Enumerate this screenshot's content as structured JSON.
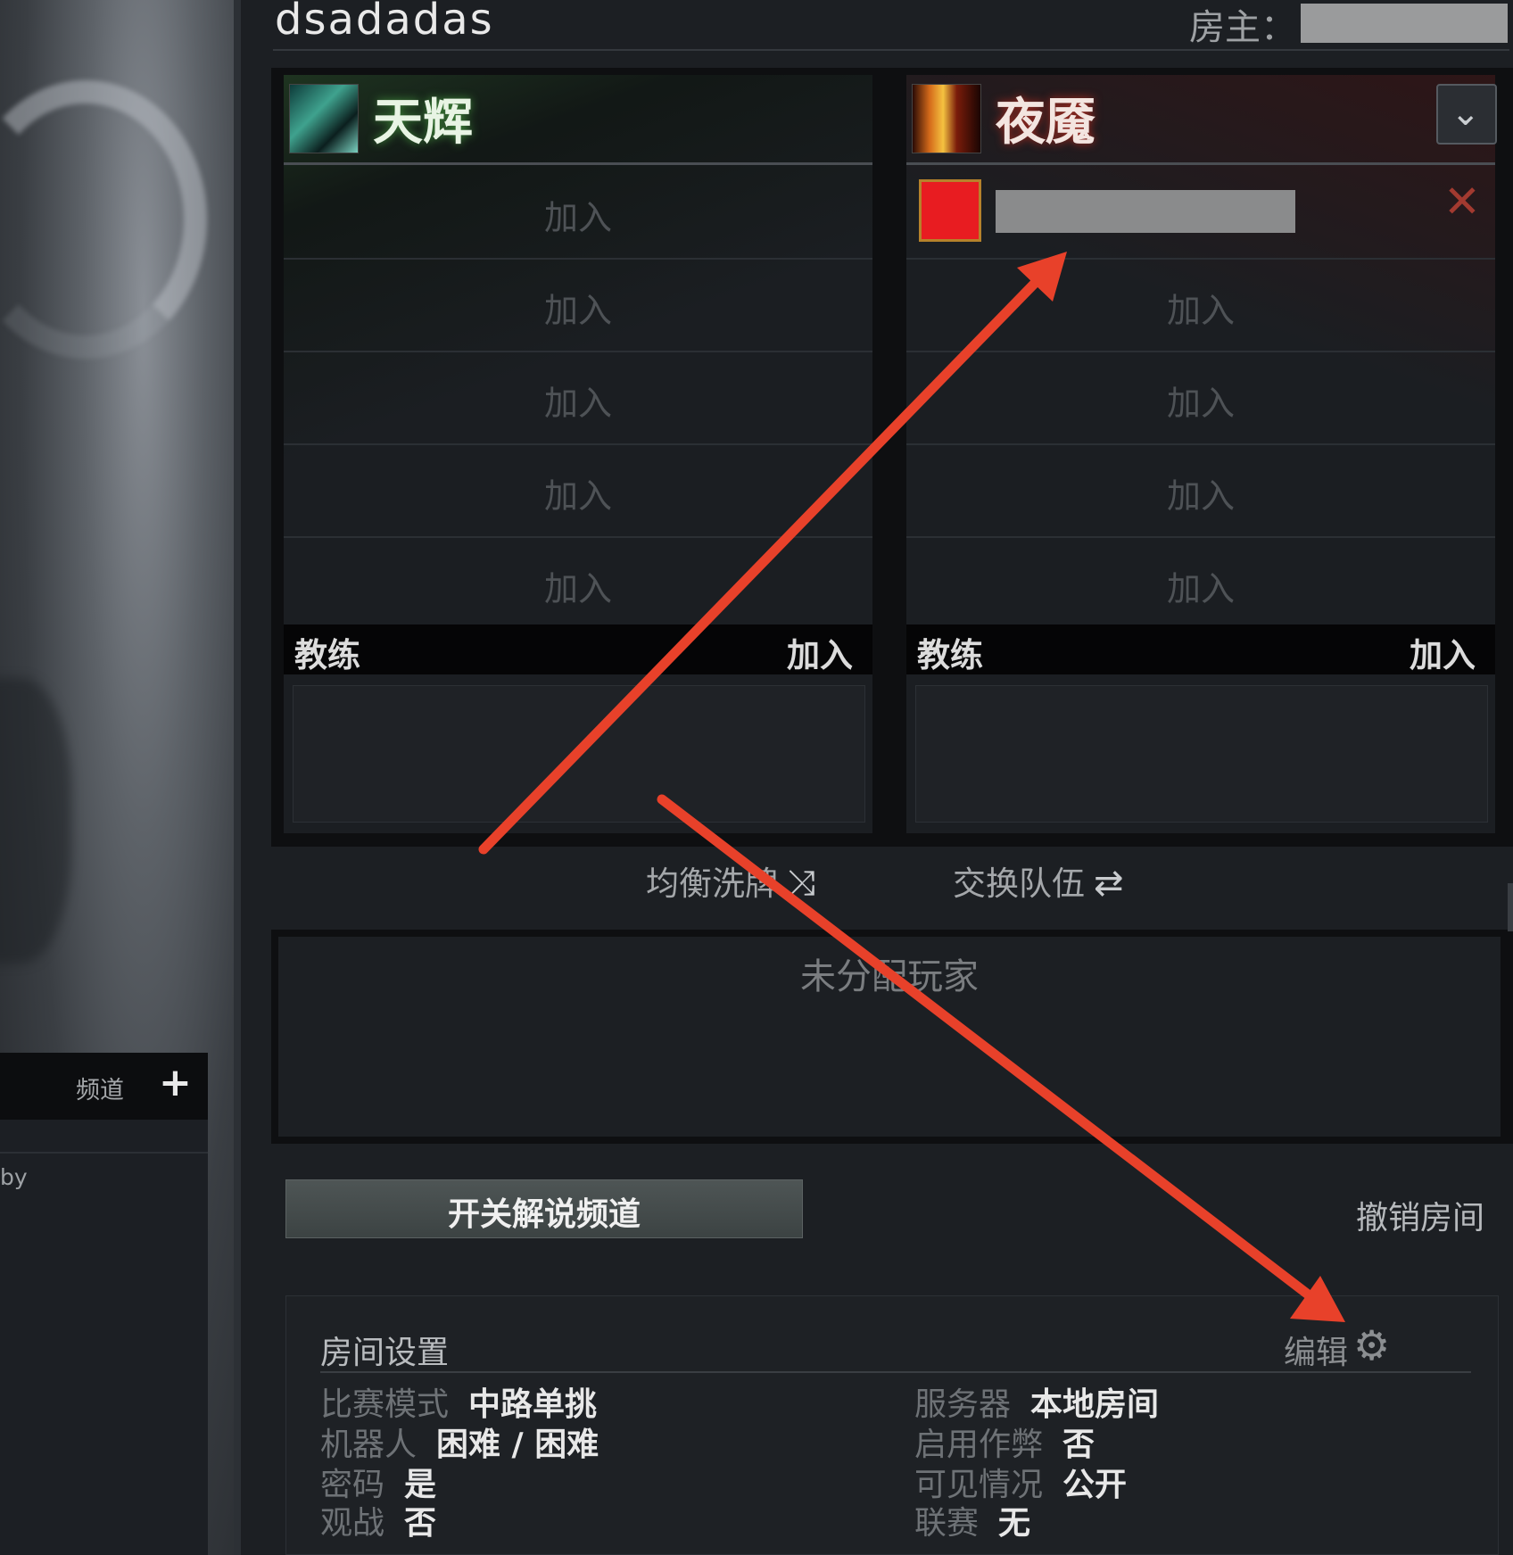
{
  "room": {
    "name": "dsadadas",
    "host_label": "房主："
  },
  "teams": {
    "radiant": {
      "name": "天辉",
      "slots": [
        "加入",
        "加入",
        "加入",
        "加入",
        "加入"
      ],
      "coach_label": "教练",
      "coach_join": "加入"
    },
    "dire": {
      "name": "夜魇",
      "slots": [
        "",
        "加入",
        "加入",
        "加入",
        "加入"
      ],
      "coach_label": "教练",
      "coach_join": "加入",
      "player_color": "#e81c21",
      "kick_glyph": "✕",
      "dropdown_glyph": "⌄"
    }
  },
  "actions": {
    "shuffle_label": "均衡洗牌",
    "shuffle_icon": "shuffle-icon",
    "swap_label": "交换队伍",
    "swap_icon": "swap-icon"
  },
  "unassigned": {
    "label": "未分配玩家"
  },
  "chat": {
    "tab_label": "频道",
    "add_glyph": "+",
    "list_item": "by"
  },
  "buttons": {
    "caster": "开关解说频道",
    "cancel": "撤销房间"
  },
  "settings": {
    "title": "房间设置",
    "edit_label": "编辑",
    "gear_glyph": "⚙",
    "left": [
      {
        "key": "比赛模式",
        "value": "中路单挑"
      },
      {
        "key": "机器人",
        "value": "困难 / 困难"
      },
      {
        "key": "密码",
        "value": "是"
      },
      {
        "key": "观战",
        "value": "否"
      }
    ],
    "right": [
      {
        "key": "服务器",
        "value": "本地房间"
      },
      {
        "key": "启用作弊",
        "value": "否"
      },
      {
        "key": "可见情况",
        "value": "公开"
      },
      {
        "key": "联赛",
        "value": "无"
      }
    ]
  },
  "colors": {
    "annotation_arrow": "#e8412a",
    "radiant_glow": "#3f8a3a",
    "dire_glow": "#a32a20"
  }
}
